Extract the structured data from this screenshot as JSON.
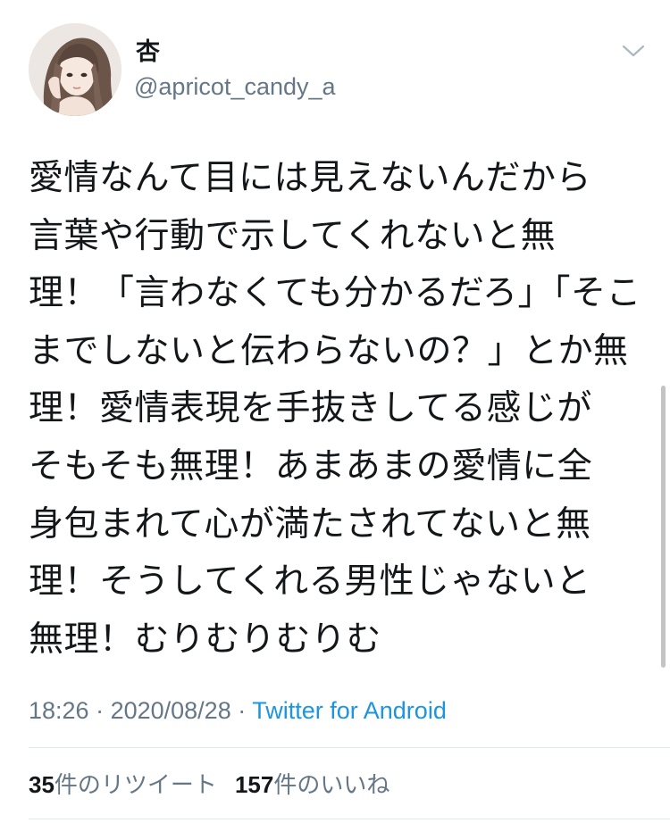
{
  "author": {
    "display_name": "杏",
    "handle": "@apricot_candy_a",
    "avatar_icon": "avatar-portrait-icon"
  },
  "menu": {
    "icon": "chevron-down-icon"
  },
  "tweet": {
    "lines": [
      "愛情なんて目には見えないんだから",
      "言葉や行動で示してくれないと無",
      "理！「言わなくても分かるだろ」「そこ",
      "までしないと伝わらないの？」とか無",
      "理！愛情表現を手抜きしてる感じが",
      "そもそも無理！あまあまの愛情に全",
      "身包まれて心が満たされてないと無",
      "理！そうしてくれる男性じゃないと",
      "無理！むりむりむりむ"
    ]
  },
  "meta": {
    "time": "18:26",
    "separator": " · ",
    "date": "2020/08/28",
    "source": "Twitter for Android"
  },
  "stats": {
    "retweets_count": "35",
    "retweets_label": "件のリツイート",
    "likes_count": "157",
    "likes_label": "件のいいね"
  },
  "colors": {
    "text": "#14171a",
    "secondary": "#657786",
    "link": "#1b95e0",
    "divider": "#e1e8ed"
  }
}
